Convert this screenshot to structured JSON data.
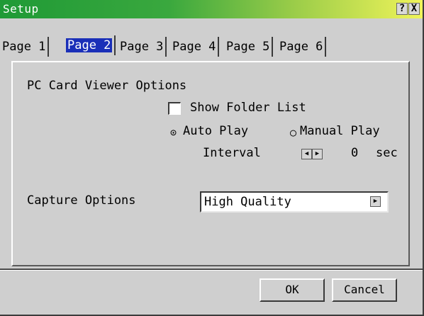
{
  "window": {
    "title": "Setup",
    "help_label": "?",
    "close_label": "X"
  },
  "tabs": [
    {
      "label": "Page 1"
    },
    {
      "label": "Page 2",
      "active": true
    },
    {
      "label": "Page 3"
    },
    {
      "label": "Page 4"
    },
    {
      "label": "Page 5"
    },
    {
      "label": "Page 6"
    }
  ],
  "pc_card": {
    "section_label": "PC Card Viewer Options",
    "show_folder_list_label": "Show Folder List",
    "show_folder_list_checked": false,
    "auto_play_label": "Auto Play",
    "auto_play_selected": true,
    "manual_play_label": "Manual Play",
    "interval_label": "Interval",
    "interval_value": "0",
    "interval_unit": "sec"
  },
  "capture": {
    "label": "Capture Options",
    "value": "High Quality"
  },
  "footer": {
    "ok_label": "OK",
    "cancel_label": "Cancel"
  }
}
